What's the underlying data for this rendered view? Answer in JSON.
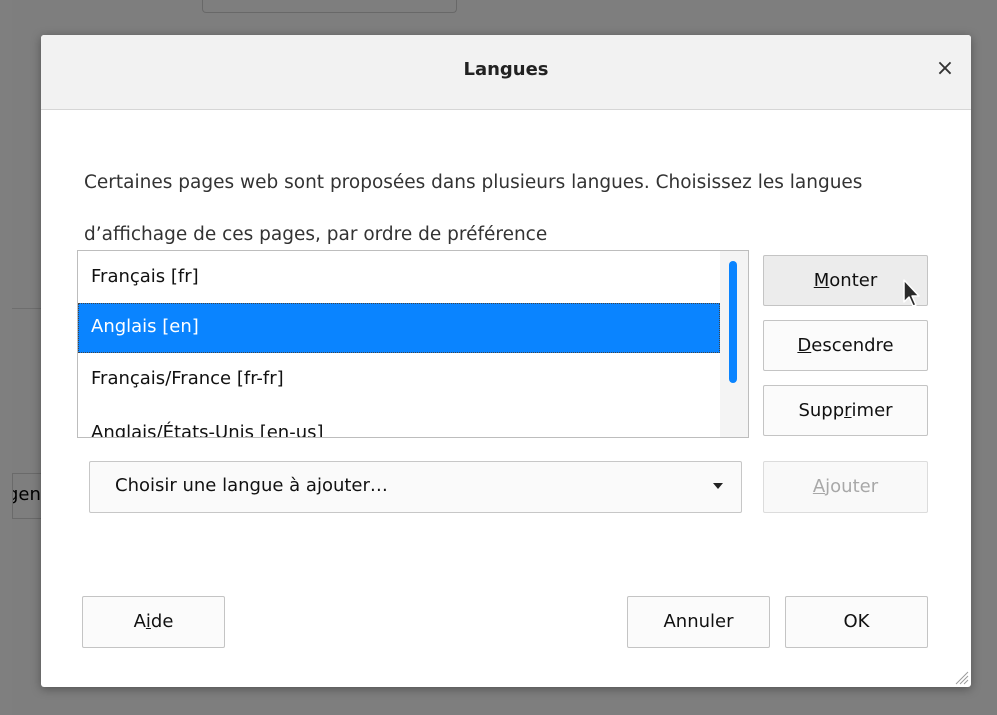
{
  "dialog": {
    "title": "Langues",
    "close_glyph": "×",
    "description": "Certaines pages web sont proposées dans plusieurs langues. Choisissez les langues d’affichage de ces pages, par ordre de préférence"
  },
  "languages": [
    {
      "label": "Français [fr]",
      "selected": false
    },
    {
      "label": "Anglais [en]",
      "selected": true
    },
    {
      "label": "Français/France [fr-fr]",
      "selected": false
    },
    {
      "label": "Anglais/États-Unis [en-us]",
      "selected": false
    }
  ],
  "buttons": {
    "up": {
      "before": "",
      "accel": "M",
      "after": "onter"
    },
    "down": {
      "before": "",
      "accel": "D",
      "after": "escendre"
    },
    "remove": {
      "before": "Supp",
      "accel": "r",
      "after": "imer"
    },
    "add": {
      "before": "",
      "accel": "A",
      "after": "jouter"
    },
    "help": {
      "before": "A",
      "accel": "i",
      "after": "de"
    },
    "cancel": {
      "label": "Annuler"
    },
    "ok": {
      "label": "OK"
    }
  },
  "select": {
    "label": "Choisir une langue à ajouter…"
  },
  "background": {
    "partial_text": "gen"
  },
  "colors": {
    "accent": "#0a84ff",
    "overlay": "#7f7f7f"
  }
}
